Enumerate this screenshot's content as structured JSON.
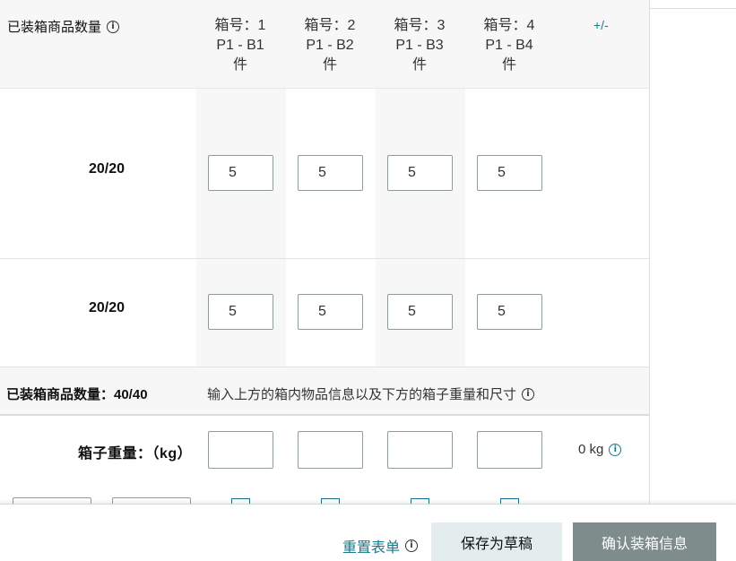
{
  "header": {
    "title": "已装箱商品数量",
    "columns": [
      {
        "box": "箱号：1",
        "range": "P1 - B1",
        "unit": "件"
      },
      {
        "box": "箱号：2",
        "range": "P1 - B2",
        "unit": "件"
      },
      {
        "box": "箱号：3",
        "range": "P1 - B3",
        "unit": "件"
      },
      {
        "box": "箱号：4",
        "range": "P1 - B4",
        "unit": "件"
      }
    ],
    "plus_minus": "+/-"
  },
  "rows": [
    {
      "count": "20/20",
      "values": [
        "5",
        "5",
        "5",
        "5"
      ]
    },
    {
      "count": "20/20",
      "values": [
        "5",
        "5",
        "5",
        "5"
      ]
    }
  ],
  "summary": {
    "total_label": "已装箱商品数量：40/40",
    "hint": "输入上方的箱内物品信息以及下方的箱子重量和尺寸"
  },
  "weight": {
    "label": "箱子重量：（kg）",
    "values": [
      "",
      "",
      "",
      ""
    ],
    "total": "0 kg"
  },
  "footer": {
    "reset": "重置表单",
    "save_draft": "保存为草稿",
    "confirm": "确认装箱信息"
  },
  "colors": {
    "accent": "#1a7a8a",
    "confirm_button": "#7e8c8c",
    "draft_button": "#e3eded"
  },
  "icons": [
    "info-icon"
  ]
}
